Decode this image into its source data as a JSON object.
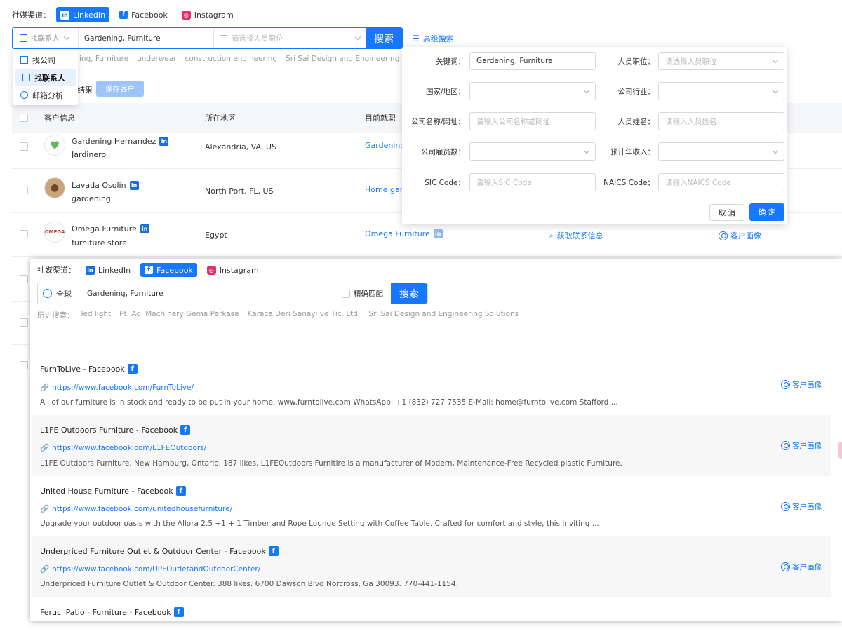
{
  "top": {
    "channel_label": "社媒渠道：",
    "tabs": [
      {
        "label": "LinkedIn",
        "icon": "in"
      },
      {
        "label": "Facebook",
        "icon": "f"
      },
      {
        "label": "Instagram",
        "icon": "ig"
      }
    ],
    "search_type": "找联系人",
    "keyword": "Gardening, Furniture",
    "position_placeholder": "请选择人员职位",
    "search_button": "搜索",
    "advanced_search": "高级搜索",
    "history": [
      "ing, Furniture",
      "underwear",
      "construction engineering",
      "Sri Sai Design and Engineering Solutions"
    ]
  },
  "dropdown": {
    "items": [
      {
        "label": "找公司",
        "icon": "building-icon"
      },
      {
        "label": "找联系人",
        "icon": "contact-icon"
      },
      {
        "label": "邮箱分析",
        "icon": "email-analysis-icon"
      }
    ]
  },
  "actions": {
    "partial_label": "结果",
    "save_button": "保存客户"
  },
  "table": {
    "headers": [
      "客户信息",
      "所在地区",
      "目前就职"
    ],
    "rows": [
      {
        "name": "Gardening Hernandez",
        "title": "Jardinero",
        "location": "Alexandria, VA, US",
        "company": "Gardening"
      },
      {
        "name": "Lavada Osolin",
        "title": "gardening",
        "location": "North Port, FL, US",
        "company": "Home gard"
      },
      {
        "name": "Omega Furniture",
        "title": "furniture store",
        "location": "Egypt",
        "company": "Omega Furniture",
        "contact": "获取联系信息",
        "portrait": "客户画像"
      }
    ]
  },
  "advanced": {
    "fields": [
      {
        "label": "关键词：",
        "value": "Gardening, Furniture",
        "placeholder": "",
        "type": "input"
      },
      {
        "label": "人员职位：",
        "value": "",
        "placeholder": "请选择人员职位",
        "type": "select"
      },
      {
        "label": "国家/地区：",
        "value": "",
        "placeholder": "",
        "type": "select"
      },
      {
        "label": "公司行业：",
        "value": "",
        "placeholder": "",
        "type": "select"
      },
      {
        "label": "公司名称/网址：",
        "value": "",
        "placeholder": "请输入公司名称或网址",
        "type": "input"
      },
      {
        "label": "人员姓名：",
        "value": "",
        "placeholder": "请输入人员姓名",
        "type": "input"
      },
      {
        "label": "公司雇员数：",
        "value": "",
        "placeholder": "",
        "type": "select"
      },
      {
        "label": "预计年收入：",
        "value": "",
        "placeholder": "",
        "type": "select"
      },
      {
        "label": "SIC Code：",
        "value": "",
        "placeholder": "请输入SIC Code",
        "type": "input"
      },
      {
        "label": "NAICS Code：",
        "value": "",
        "placeholder": "请输入NAICS Code",
        "type": "input"
      }
    ],
    "cancel": "取 消",
    "confirm": "确 定"
  },
  "facebook": {
    "channel_label": "社媒渠道：",
    "tabs": [
      {
        "label": "LinkedIn"
      },
      {
        "label": "Facebook"
      },
      {
        "label": "Instagram"
      }
    ],
    "region": "全球",
    "keyword": "Gardening, Furniture",
    "exact_match": "精确匹配",
    "search_button": "搜索",
    "history_label": "历史搜索：",
    "history": [
      "led light",
      "Pt. Adi Machinery Gema Perkasa",
      "Karaca Deri Sanayi ve Tic. Ltd.",
      "Sri Sai Design and Engineering Solutions"
    ],
    "results": [
      {
        "title": "FurnToLive - Facebook",
        "url": "https://www.facebook.com/FurnToLive/",
        "desc": "All of our furniture is in stock and ready to be put in your home. www.furntolive.com WhatsApp: +1 (832) 727 7535 E-Mail: home@furntolive.com Stafford ...",
        "portrait": "客户画像"
      },
      {
        "title": "L1FE Outdoors Furniture - Facebook",
        "url": "https://www.facebook.com/L1FEOutdoors/",
        "desc": "L1FE Outdoors Furniture, New Hamburg, Ontario. 187 likes. L1FEOutdoors Furnitire is a manufacturer of Modern, Maintenance-Free Recycled plastic Furniture.",
        "portrait": "客户画像"
      },
      {
        "title": "United House Furniture - Facebook",
        "url": "https://www.facebook.com/unitedhousefurniture/",
        "desc": "Upgrade your outdoor oasis with the Allora 2.5 +1 + 1 Timber and Rope Lounge Setting with Coffee Table. Crafted for comfort and style, this inviting ...",
        "portrait": "客户画像"
      },
      {
        "title": "Underpriced Furniture Outlet & Outdoor Center - Facebook",
        "url": "https://www.facebook.com/UPFOutletandOutdoorCenter/",
        "desc": "Underpriced Furniture Outlet & Outdoor Center. 388 likes. 6700 Dawson Blvd Norcross, Ga 30093. 770-441-1154.",
        "portrait": "客户画像"
      },
      {
        "title": "Feruci Patio - Furniture - Facebook",
        "url": "",
        "desc": "",
        "portrait": ""
      }
    ]
  }
}
